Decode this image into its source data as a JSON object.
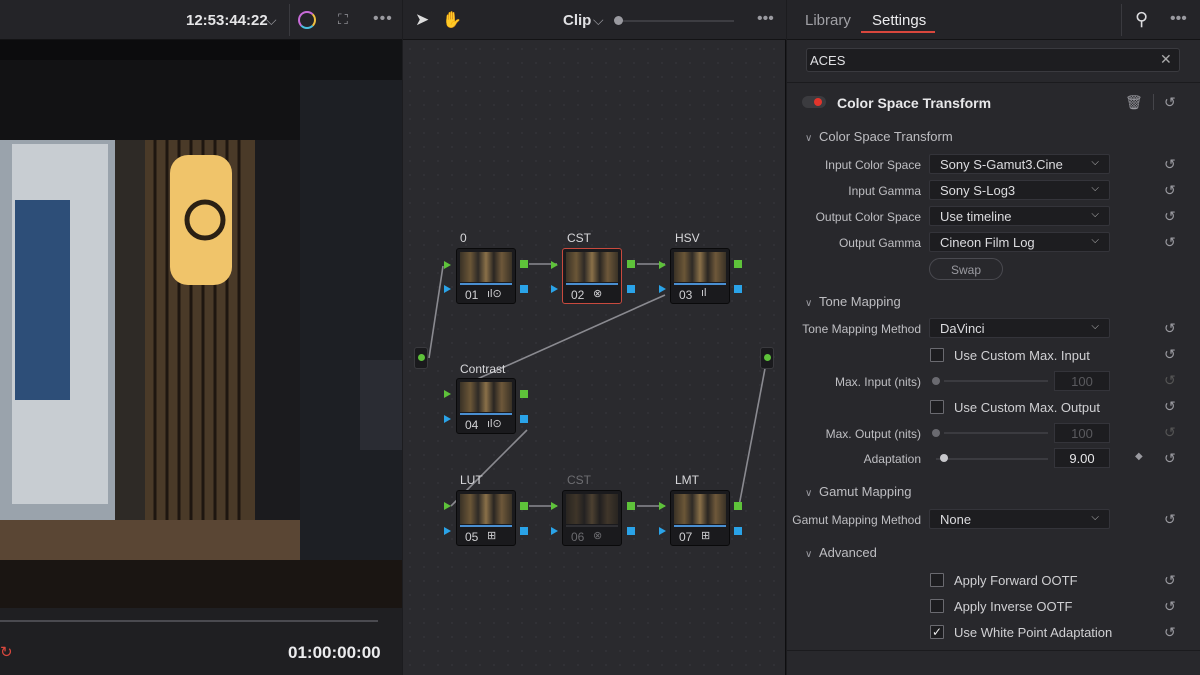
{
  "viewer": {
    "timecode_top": "12:53:44:22",
    "timecode_bottom": "01:00:00:00"
  },
  "node_editor": {
    "clip_label": "Clip",
    "nodes": [
      {
        "label": "0",
        "num": "01",
        "icons": "ıl⊙"
      },
      {
        "label": "CST",
        "num": "02",
        "icons": "⊗"
      },
      {
        "label": "HSV",
        "num": "03",
        "icons": "ıl"
      },
      {
        "label": "Contrast",
        "num": "04",
        "icons": "ıl⊙"
      },
      {
        "label": "LUT",
        "num": "05",
        "icons": "⊞"
      },
      {
        "label": "CST",
        "num": "06",
        "icons": "⊗"
      },
      {
        "label": "LMT",
        "num": "07",
        "icons": "⊞"
      }
    ]
  },
  "settings": {
    "tabs": [
      "Library",
      "Settings"
    ],
    "active_tab": "Settings",
    "search_value": "ACES",
    "effect_title": "Color Space Transform",
    "sections": {
      "cst": "Color Space Transform",
      "tone": "Tone Mapping",
      "gamut": "Gamut Mapping",
      "advanced": "Advanced"
    },
    "fields": {
      "input_color_space": {
        "label": "Input Color Space",
        "value": "Sony S-Gamut3.Cine"
      },
      "input_gamma": {
        "label": "Input Gamma",
        "value": "Sony S-Log3"
      },
      "output_color_space": {
        "label": "Output Color Space",
        "value": "Use timeline"
      },
      "output_gamma": {
        "label": "Output Gamma",
        "value": "Cineon Film Log"
      },
      "swap": "Swap",
      "tone_method": {
        "label": "Tone Mapping Method",
        "value": "DaVinci"
      },
      "custom_max_input": {
        "label": "Use Custom Max. Input",
        "checked": false
      },
      "max_input": {
        "label": "Max. Input (nits)",
        "value": "100"
      },
      "custom_max_output": {
        "label": "Use Custom Max. Output",
        "checked": false
      },
      "max_output": {
        "label": "Max. Output (nits)",
        "value": "100"
      },
      "adaptation": {
        "label": "Adaptation",
        "value": "9.00"
      },
      "gamut_method": {
        "label": "Gamut Mapping Method",
        "value": "None"
      },
      "forward_ootf": {
        "label": "Apply Forward OOTF",
        "checked": false
      },
      "inverse_ootf": {
        "label": "Apply Inverse OOTF",
        "checked": false
      },
      "white_point": {
        "label": "Use White Point Adaptation",
        "checked": true
      }
    }
  },
  "colors": {
    "accent_red": "#d9473d",
    "port_green": "#5ec23a",
    "port_blue": "#2aa3e8"
  }
}
